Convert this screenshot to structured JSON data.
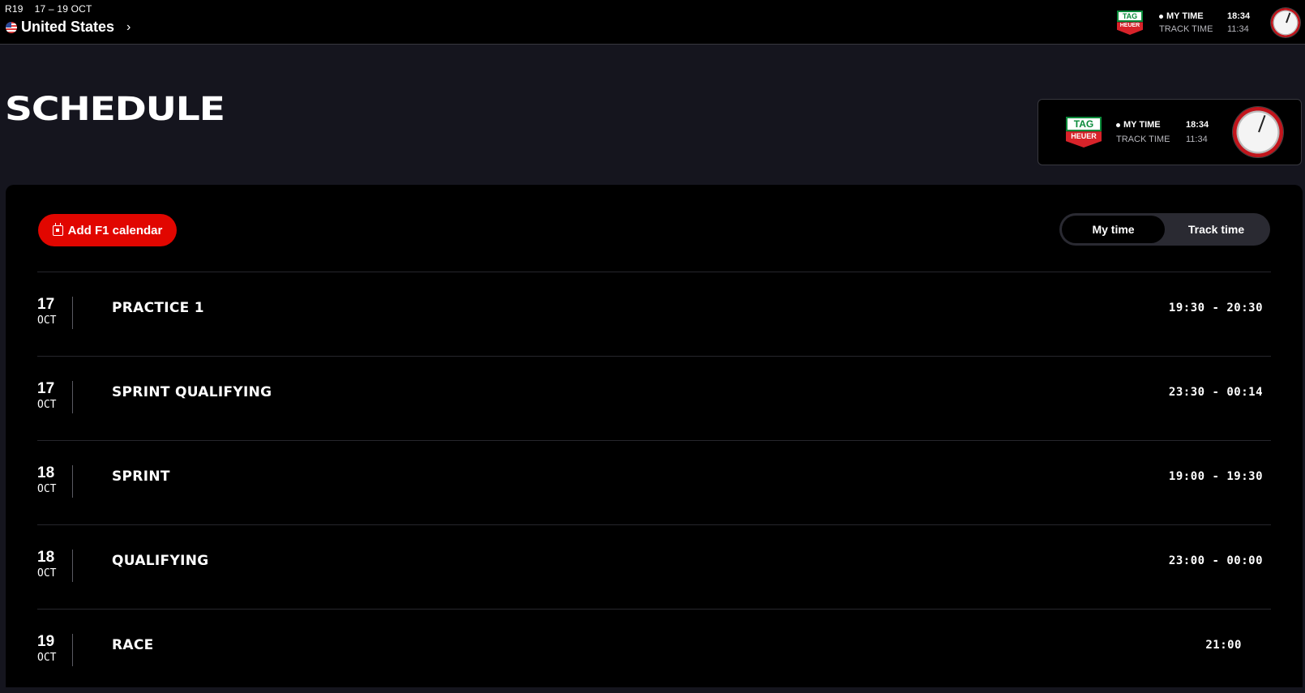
{
  "event": {
    "round": "R19",
    "dates": "17 – 19 OCT",
    "country": "United States",
    "flag_icon": "us-flag-icon",
    "chevron_icon": "chevron-right-icon"
  },
  "clock": {
    "brand_top": "TAG",
    "brand_bottom": "HEUER",
    "my_time_label": "MY TIME",
    "my_time_value": "18:34",
    "track_time_label": "TRACK TIME",
    "track_time_value": "11:34"
  },
  "page": {
    "title": "SCHEDULE"
  },
  "actions": {
    "add_calendar_label": "Add F1 calendar",
    "add_calendar_icon": "calendar-add-icon"
  },
  "time_toggle": {
    "options": [
      "My time",
      "Track time"
    ],
    "selected": "My time"
  },
  "sessions": [
    {
      "day": "17",
      "month": "OCT",
      "name": "PRACTICE 1",
      "time": "19:30 - 20:30"
    },
    {
      "day": "17",
      "month": "OCT",
      "name": "SPRINT QUALIFYING",
      "time": "23:30 - 00:14"
    },
    {
      "day": "18",
      "month": "OCT",
      "name": "SPRINT",
      "time": "19:00 - 19:30"
    },
    {
      "day": "18",
      "month": "OCT",
      "name": "QUALIFYING",
      "time": "23:00 - 00:00"
    },
    {
      "day": "19",
      "month": "OCT",
      "name": "RACE",
      "time": "21:00"
    }
  ],
  "colors": {
    "accent": "#e10600",
    "background": "#15151e",
    "panel": "#000000",
    "divider": "#26262c"
  }
}
